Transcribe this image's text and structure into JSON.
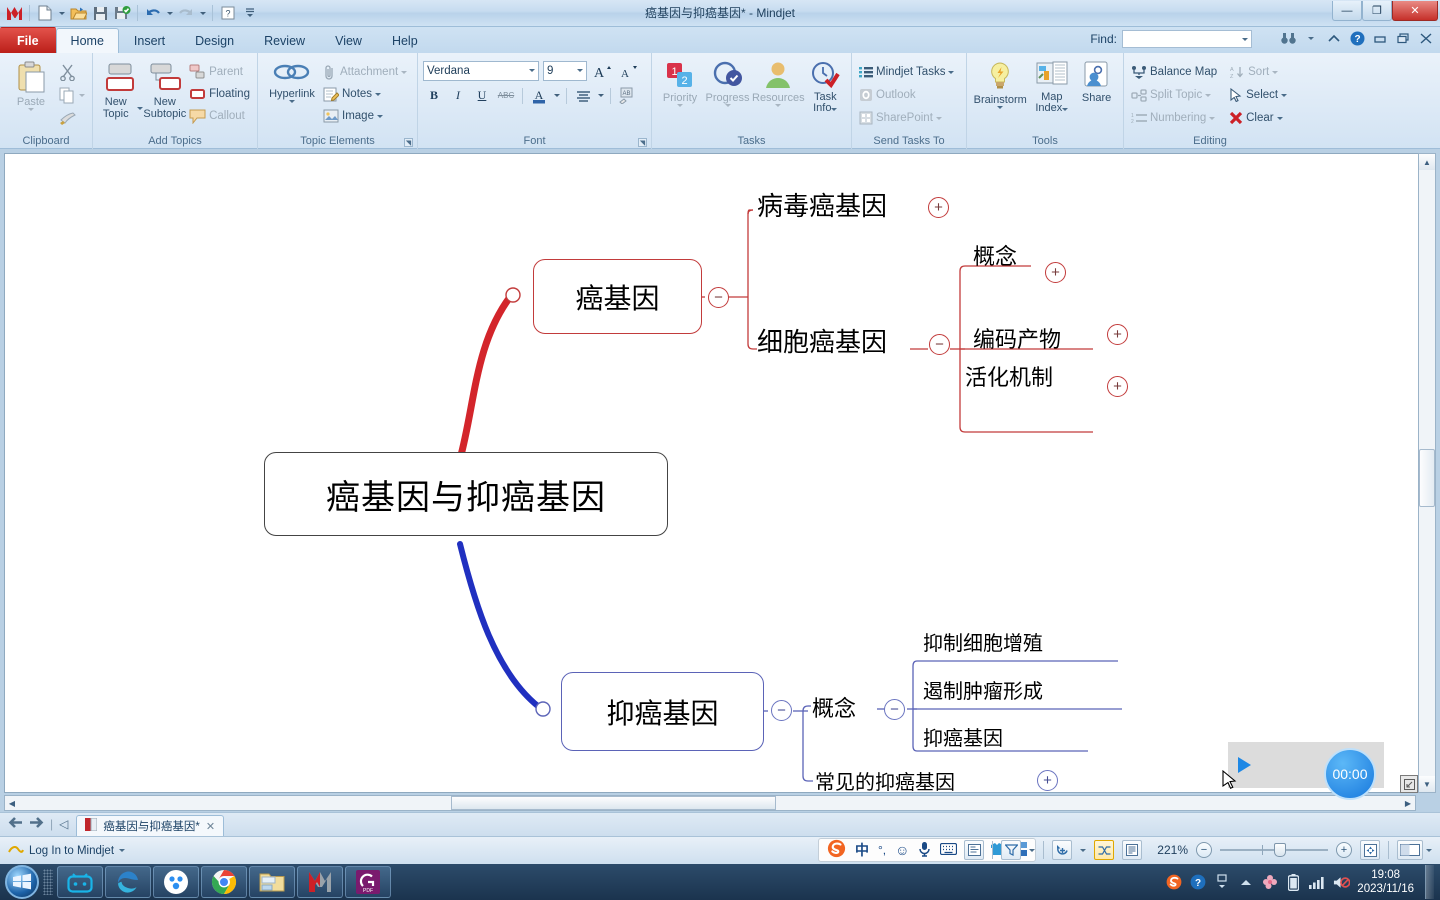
{
  "window": {
    "title": "癌基因与抑癌基因* - Mindjet",
    "minimize": "—",
    "restore": "❐",
    "close": "✕"
  },
  "quick_access": {
    "items": [
      {
        "name": "mindjet-logo",
        "label": "Mindjet"
      },
      {
        "name": "new-document",
        "label": "New"
      },
      {
        "name": "open-file",
        "label": "Open"
      },
      {
        "name": "save-file",
        "label": "Save"
      },
      {
        "name": "save-and-check",
        "label": "Save & Check"
      },
      {
        "name": "undo",
        "label": "Undo"
      },
      {
        "name": "redo",
        "label": "Redo"
      },
      {
        "name": "help",
        "label": "Help"
      },
      {
        "name": "customize-toolbar",
        "label": "Customize"
      }
    ]
  },
  "tabs": [
    {
      "label": "File",
      "active": false,
      "kind": "file"
    },
    {
      "label": "Home",
      "active": true,
      "kind": "normal"
    },
    {
      "label": "Insert",
      "active": false,
      "kind": "normal"
    },
    {
      "label": "Design",
      "active": false,
      "kind": "normal"
    },
    {
      "label": "Review",
      "active": false,
      "kind": "normal"
    },
    {
      "label": "View",
      "active": false,
      "kind": "normal"
    },
    {
      "label": "Help",
      "active": false,
      "kind": "normal"
    }
  ],
  "find": {
    "label": "Find:",
    "value": "",
    "placeholder": ""
  },
  "ribbon": {
    "clipboard": {
      "name": "Clipboard",
      "paste": "Paste",
      "cut": "Cut",
      "copy": "Copy",
      "format_painter": "Format Painter"
    },
    "add_topics": {
      "name": "Add Topics",
      "new_topic": "New Topic",
      "new_subtopic": "New Subtopic",
      "parent": "Parent",
      "floating": "Floating",
      "callout": "Callout"
    },
    "topic_elements": {
      "name": "Topic Elements",
      "hyperlink": "Hyperlink",
      "attachment": "Attachment",
      "notes": "Notes",
      "image": "Image"
    },
    "font": {
      "name": "Font",
      "family": "Verdana",
      "size": "9",
      "grow": "A",
      "shrink": "A",
      "bold": "B",
      "italic": "I",
      "underline": "U",
      "strikethrough": "ABC",
      "font_color": "A",
      "align": "Align",
      "clear_format": "Clear Formatting"
    },
    "tasks": {
      "name": "Tasks",
      "priority": "Priority",
      "progress": "Progress",
      "resources": "Resources",
      "task_info": "Task Info"
    },
    "send_tasks_to": {
      "name": "Send Tasks To",
      "mindjet_tasks": "Mindjet Tasks",
      "outlook": "Outlook",
      "sharepoint": "SharePoint"
    },
    "tools": {
      "name": "Tools",
      "brainstorm": "Brainstorm",
      "map_index": "Map Index",
      "share": "Share"
    },
    "editing": {
      "name": "Editing",
      "balance_map": "Balance Map",
      "split_topic": "Split Topic",
      "numbering": "Numbering",
      "sort": "Sort",
      "select": "Select",
      "clear": "Clear"
    }
  },
  "mindmap": {
    "central": "癌基因与抑癌基因",
    "branches": [
      {
        "label": "癌基因",
        "color": "#c23b3b",
        "toggle": "−",
        "children": [
          {
            "label": "病毒癌基因",
            "toggle": "+"
          },
          {
            "label": "细胞癌基因",
            "toggle": "−",
            "children": [
              {
                "label": "概念",
                "toggle": "+"
              },
              {
                "label": "编码产物",
                "toggle": "+"
              },
              {
                "label": "活化机制",
                "toggle": "+"
              }
            ]
          }
        ]
      },
      {
        "label": "抑癌基因",
        "color": "#5b63b7",
        "toggle": "−",
        "children": [
          {
            "label": "概念",
            "toggle": "−",
            "children": [
              {
                "label": "抑制细胞增殖"
              },
              {
                "label": "遏制肿瘤形成"
              },
              {
                "label": "抑癌基因"
              }
            ]
          },
          {
            "label": "常见的抑癌基因",
            "toggle": "+"
          }
        ]
      }
    ]
  },
  "recorder": {
    "timer": "00:00",
    "play": "▶"
  },
  "doc_tab": {
    "label": "癌基因与抑癌基因*",
    "close": "✕"
  },
  "statusbar": {
    "login": "Log In to Mindjet",
    "zoom": "221%",
    "zoom_out": "−",
    "zoom_in": "+",
    "fit": "Fit to page"
  },
  "ime": {
    "logo": "S",
    "mode": "中",
    "punctuation": "°,",
    "emoji": "☺",
    "voice": "🎤",
    "keyboard": "⌨",
    "user": "👤",
    "skin": "👕",
    "toolbox": "▦"
  },
  "taskbar": {
    "items": [
      {
        "name": "start-orb",
        "label": "Start"
      },
      {
        "name": "bilibili-app",
        "label": "Bilibili"
      },
      {
        "name": "microsoft-edge-app",
        "label": "Microsoft Edge"
      },
      {
        "name": "baidu-netdisk-app",
        "label": "Baidu"
      },
      {
        "name": "google-chrome-app",
        "label": "Google Chrome"
      },
      {
        "name": "file-explorer-app",
        "label": "File Explorer"
      },
      {
        "name": "mindjet-app",
        "label": "Mindjet"
      },
      {
        "name": "pdf-app",
        "label": "PDF"
      }
    ]
  },
  "tray": {
    "time": "19:08",
    "date": "2023/11/16"
  }
}
